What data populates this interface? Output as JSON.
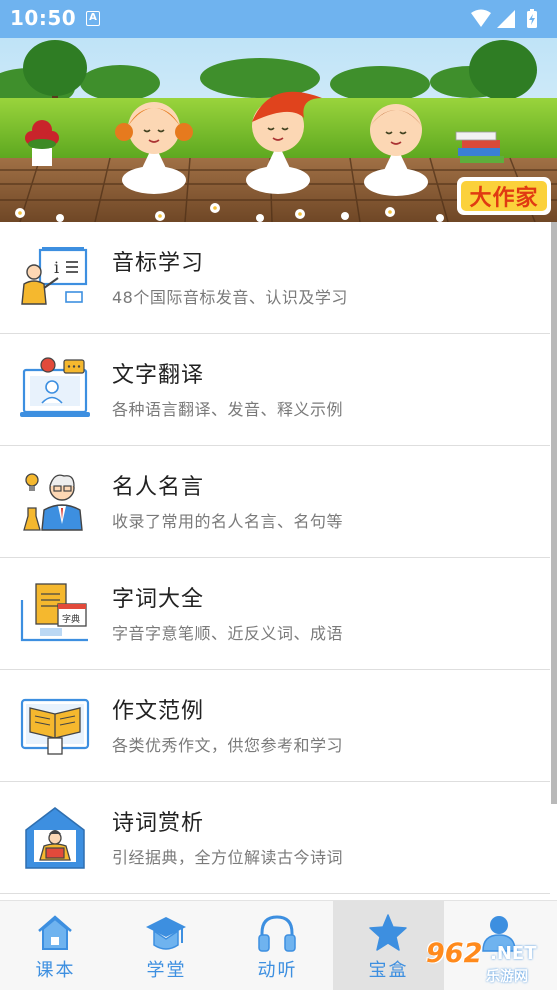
{
  "status_bar": {
    "time": "10:50",
    "app_icon_letter": "A"
  },
  "banner": {
    "badge_text": "大作家"
  },
  "items": [
    {
      "title": "音标学习",
      "desc": "48个国际音标发音、认识及学习",
      "icon": "teacher-board-icon"
    },
    {
      "title": "文字翻译",
      "desc": "各种语言翻译、发音、释义示例",
      "icon": "monitor-chat-icon"
    },
    {
      "title": "名人名言",
      "desc": "收录了常用的名人名言、名句等",
      "icon": "scientist-icon"
    },
    {
      "title": "字词大全",
      "desc": "字音字意笔顺、近反义词、成语",
      "icon": "dictionary-icon"
    },
    {
      "title": "作文范例",
      "desc": "各类优秀作文，供您参考和学习",
      "icon": "open-book-icon"
    },
    {
      "title": "诗词赏析",
      "desc": "引经据典，全方位解读古今诗词",
      "icon": "reading-house-icon"
    }
  ],
  "nav": [
    {
      "label": "课本",
      "icon": "house-icon",
      "active": false
    },
    {
      "label": "学堂",
      "icon": "graduation-cap-icon",
      "active": false
    },
    {
      "label": "动听",
      "icon": "headphones-icon",
      "active": false
    },
    {
      "label": "宝盒",
      "icon": "star-icon",
      "active": true
    },
    {
      "label": "",
      "icon": "user-icon",
      "active": false
    }
  ],
  "watermark": {
    "number": "962",
    "suffix": ".NET",
    "site": "乐游网"
  },
  "colors": {
    "status_bar": "#6fb3ef",
    "accent": "#3d8fe0",
    "watermark_orange": "#ff8a1c"
  }
}
